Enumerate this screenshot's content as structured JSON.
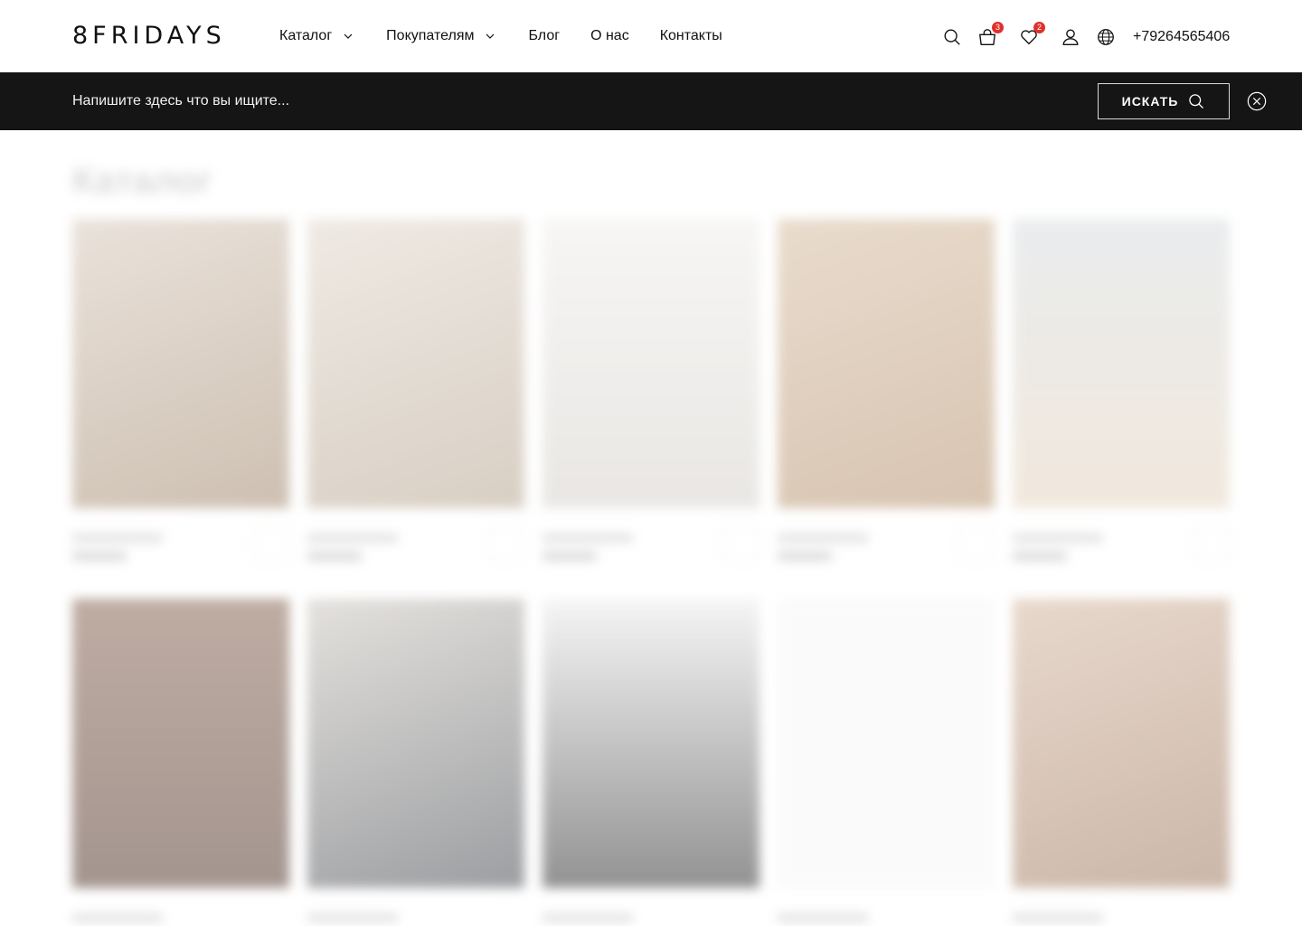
{
  "header": {
    "logo": "8FRIDAYS",
    "nav": [
      {
        "label": "Каталог",
        "dropdown": true
      },
      {
        "label": "Покупателям",
        "dropdown": true
      },
      {
        "label": "Блог",
        "dropdown": false
      },
      {
        "label": "О нас",
        "dropdown": false
      },
      {
        "label": "Контакты",
        "dropdown": false
      }
    ],
    "cart_count": "3",
    "wishlist_count": "2",
    "phone": "+79264565406"
  },
  "search": {
    "placeholder": "Напишите здесь что вы ищите...",
    "button_label": "ИСКАТЬ"
  },
  "colors": {
    "search_bar_bg": "#151515",
    "badge": "#e0302b"
  },
  "icons": [
    "search-icon",
    "cart-icon",
    "heart-icon",
    "user-icon",
    "globe-icon",
    "close-icon",
    "chevron-down-icon"
  ],
  "catalog_background": {
    "state": "blurred",
    "title": "Каталог"
  }
}
